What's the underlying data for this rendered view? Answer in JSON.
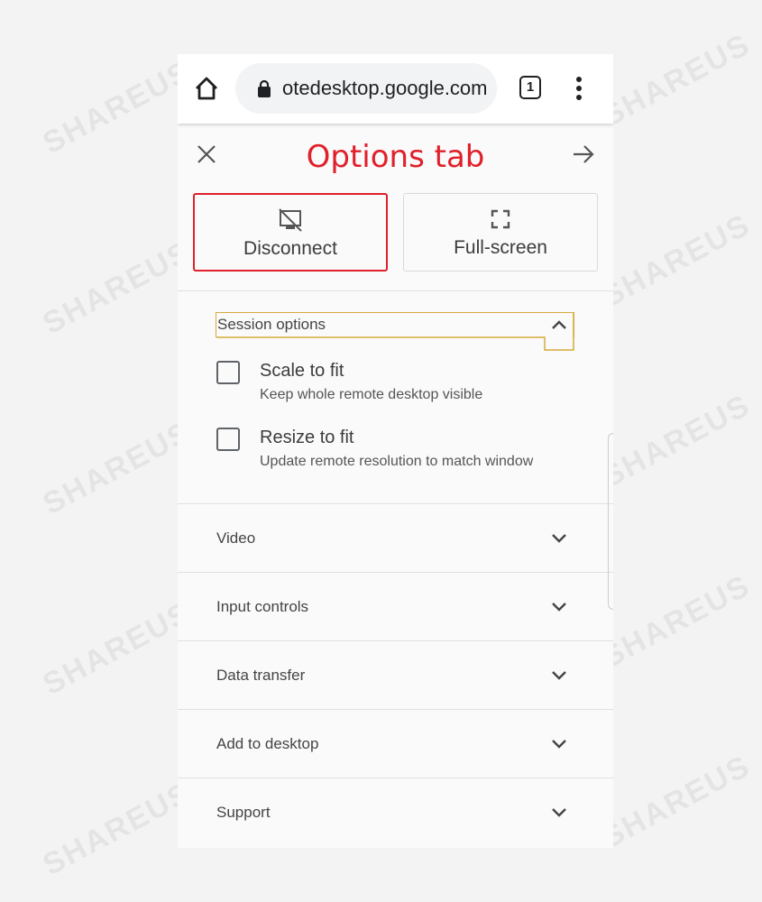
{
  "watermark": "SHAREUS",
  "browser": {
    "url": "otedesktop.google.com",
    "tab_count": "1"
  },
  "panel": {
    "title": "Options tab",
    "buttons": [
      {
        "label": "Disconnect"
      },
      {
        "label": "Full-screen"
      }
    ],
    "session": {
      "header": "Session options",
      "options": [
        {
          "title": "Scale to fit",
          "subtitle": "Keep whole remote desktop visible",
          "checked": false
        },
        {
          "title": "Resize to fit",
          "subtitle": "Update remote resolution to match window",
          "checked": false
        }
      ]
    },
    "sections": [
      {
        "label": "Video"
      },
      {
        "label": "Input controls"
      },
      {
        "label": "Data transfer"
      },
      {
        "label": "Add to desktop"
      },
      {
        "label": "Support"
      }
    ]
  },
  "colors": {
    "annotation": "#e0202a",
    "focus": "#d6a93a"
  }
}
